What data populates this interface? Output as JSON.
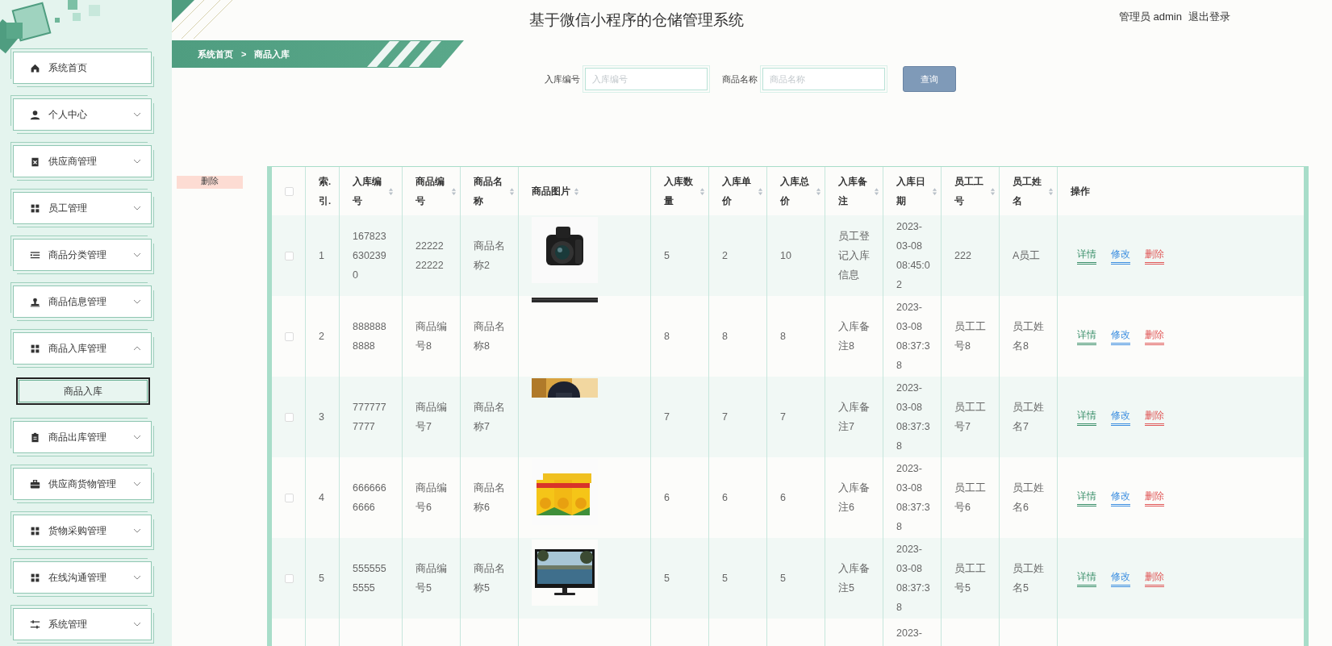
{
  "header": {
    "title": "基于微信小程序的仓储管理系统",
    "user": "管理员 admin",
    "logout": "退出登录"
  },
  "sidebar": {
    "items": [
      {
        "label": "系统首页"
      },
      {
        "label": "个人中心",
        "expanded": false
      },
      {
        "label": "供应商管理",
        "expanded": false
      },
      {
        "label": "员工管理",
        "expanded": false
      },
      {
        "label": "商品分类管理",
        "expanded": false
      },
      {
        "label": "商品信息管理",
        "expanded": false
      },
      {
        "label": "商品入库管理",
        "expanded": true,
        "children": [
          {
            "label": "商品入库",
            "selected": true
          }
        ]
      },
      {
        "label": "商品出库管理",
        "expanded": false
      },
      {
        "label": "供应商货物管理",
        "expanded": false
      },
      {
        "label": "货物采购管理",
        "expanded": false
      },
      {
        "label": "在线沟通管理",
        "expanded": false
      },
      {
        "label": "系统管理",
        "expanded": false
      }
    ]
  },
  "breadcrumb": {
    "items": [
      "系统首页",
      "商品入库"
    ],
    "separator": ">"
  },
  "search": {
    "fields": [
      {
        "label": "入库编号",
        "placeholder": "入库编号"
      },
      {
        "label": "商品名称",
        "placeholder": "商品名称"
      }
    ],
    "button": "查询"
  },
  "delete_button": "删除",
  "table": {
    "all_checked": false,
    "columns": [
      {
        "label": "索.引.",
        "sortable": false
      },
      {
        "label": "入库编号",
        "sortable": true
      },
      {
        "label": "商品编号",
        "sortable": true
      },
      {
        "label": "商品名称",
        "sortable": true
      },
      {
        "label": "商品图片",
        "sortable": true
      },
      {
        "label": "入库数量",
        "sortable": true
      },
      {
        "label": "入库单价",
        "sortable": true
      },
      {
        "label": "入库总价",
        "sortable": true
      },
      {
        "label": "入库备注",
        "sortable": true
      },
      {
        "label": "入库日期",
        "sortable": true
      },
      {
        "label": "员工工号",
        "sortable": true
      },
      {
        "label": "员工姓名",
        "sortable": true
      },
      {
        "label": "操作",
        "sortable": false
      }
    ],
    "rows": [
      {
        "checked": false,
        "cells": [
          "1",
          "1678236302390",
          "2222222222",
          "商品名称2",
          {
            "kind": "picture"
          },
          "5",
          "2",
          "10",
          "员工登记入库信息",
          "2023-03-08 08:45:02",
          "222",
          "A员工"
        ],
        "actions": [
          {
            "label": "详情",
            "color": "#3a8f6a"
          },
          {
            "label": "修改",
            "color": "#3c8ee0"
          },
          {
            "label": "删除",
            "color": "#e05858"
          }
        ]
      },
      {
        "checked": false,
        "cells": [
          "2",
          "8888888888",
          "商品编号8",
          "商品名称8",
          {
            "kind": "picture"
          },
          "8",
          "8",
          "8",
          "入库备注8",
          "2023-03-08 08:37:38",
          "员工工号8",
          "员工姓名8"
        ],
        "actions": [
          {
            "label": "详情",
            "color": "#3a8f6a"
          },
          {
            "label": "修改",
            "color": "#3c8ee0"
          },
          {
            "label": "删除",
            "color": "#e05858"
          }
        ]
      },
      {
        "checked": false,
        "cells": [
          "3",
          "7777777777",
          "商品编号7",
          "商品名称7",
          {
            "kind": "picture"
          },
          "7",
          "7",
          "7",
          "入库备注7",
          "2023-03-08 08:37:38",
          "员工工号7",
          "员工姓名7"
        ],
        "actions": [
          {
            "label": "详情",
            "color": "#3a8f6a"
          },
          {
            "label": "修改",
            "color": "#3c8ee0"
          },
          {
            "label": "删除",
            "color": "#e05858"
          }
        ]
      },
      {
        "checked": false,
        "cells": [
          "4",
          "6666666666",
          "商品编号6",
          "商品名称6",
          {
            "kind": "picture"
          },
          "6",
          "6",
          "6",
          "入库备注6",
          "2023-03-08 08:37:38",
          "员工工号6",
          "员工姓名6"
        ],
        "actions": [
          {
            "label": "详情",
            "color": "#3a8f6a"
          },
          {
            "label": "修改",
            "color": "#3c8ee0"
          },
          {
            "label": "删除",
            "color": "#e05858"
          }
        ]
      },
      {
        "checked": false,
        "cells": [
          "5",
          "5555555555",
          "商品编号5",
          "商品名称5",
          {
            "kind": "picture"
          },
          "5",
          "5",
          "5",
          "入库备注5",
          "2023-03-08 08:37:38",
          "员工工号5",
          "员工姓名5"
        ],
        "actions": [
          {
            "label": "详情",
            "color": "#3a8f6a"
          },
          {
            "label": "修改",
            "color": "#3c8ee0"
          },
          {
            "label": "删除",
            "color": "#e05858"
          }
        ]
      },
      {
        "cells": [
          null,
          null,
          null,
          null,
          null,
          null,
          null,
          null,
          null,
          "2023-",
          null,
          null
        ]
      }
    ]
  }
}
